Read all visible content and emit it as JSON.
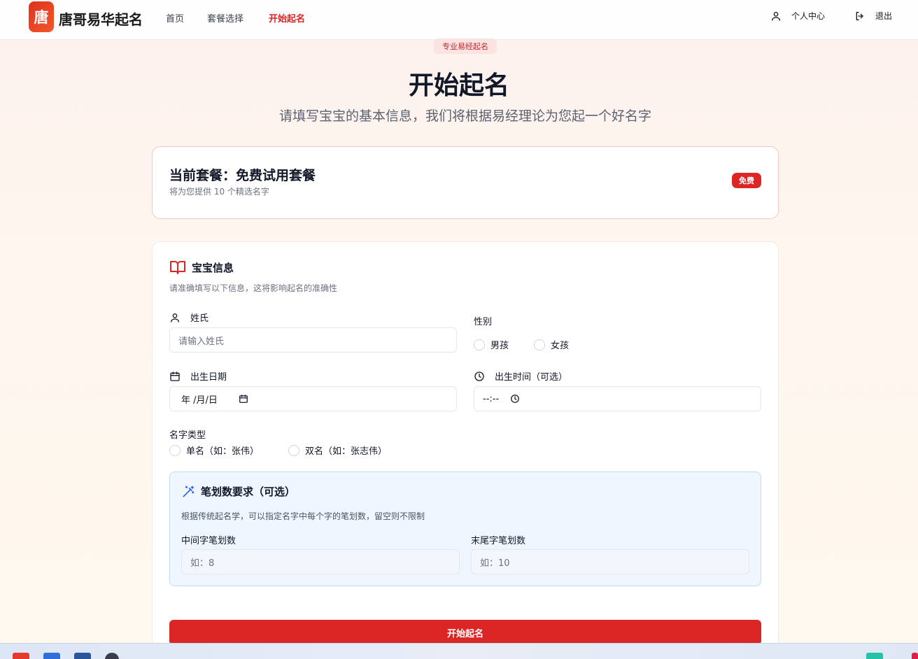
{
  "header": {
    "logo_char": "唐",
    "brand": "唐哥易华起名",
    "nav": [
      "首页",
      "套餐选择",
      "开始起名"
    ],
    "active_nav": "开始起名",
    "profile_label": "个人中心",
    "logout_label": "退出"
  },
  "hero": {
    "tag": "专业易经起名",
    "title": "开始起名",
    "subtitle": "请填写宝宝的基本信息，我们将根据易经理论为您起一个好名字"
  },
  "plan": {
    "title": "当前套餐：免费试用套餐",
    "description": "将为您提供 10 个精选名字",
    "badge": "免费"
  },
  "form": {
    "title": "宝宝信息",
    "description": "请准确填写以下信息，这将影响起名的准确性",
    "surname": {
      "label": "姓氏",
      "placeholder": "请输入姓氏"
    },
    "gender": {
      "label": "性别",
      "options": [
        "男孩",
        "女孩"
      ]
    },
    "birth_date": {
      "label": "出生日期",
      "value": "年 /月/日"
    },
    "birth_time": {
      "label": "出生时间（可选）",
      "value": "--:--"
    },
    "name_type": {
      "label": "名字类型",
      "options": [
        "单名（如：张伟）",
        "双名（如：张志伟）"
      ]
    },
    "strokes": {
      "title": "笔划数要求（可选）",
      "description": "根据传统起名学，可以指定名字中每个字的笔划数，留空则不限制",
      "middle": {
        "label": "中间字笔划数",
        "placeholder": "如：8"
      },
      "last": {
        "label": "末尾字笔划数",
        "placeholder": "如：10"
      }
    },
    "submit_label": "开始起名"
  },
  "colors": {
    "accent": "#dc2626",
    "panel_bg": "#eff6ff"
  }
}
